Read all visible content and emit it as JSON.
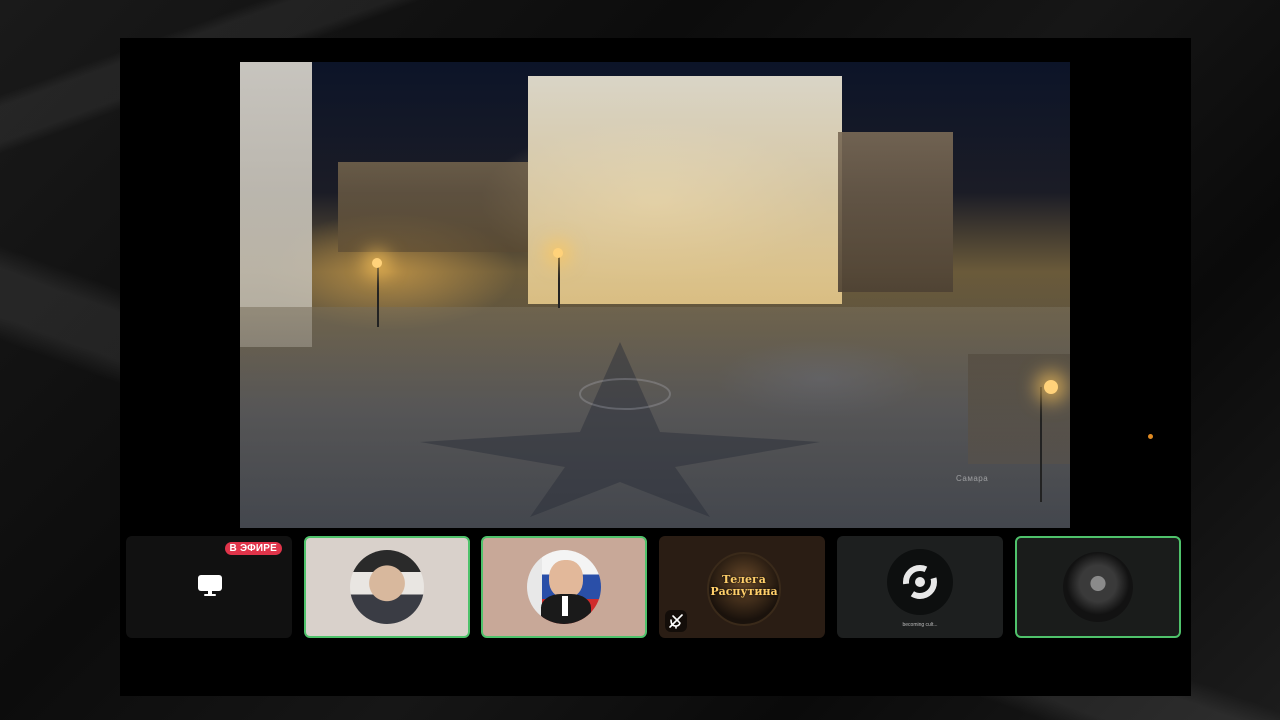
{
  "main_video": {
    "watermark": "Самара"
  },
  "participants": [
    {
      "id": "screen-share",
      "badge": "В ЭФИРЕ",
      "icon": "monitor-icon",
      "active": false,
      "bg": "#111111"
    },
    {
      "id": "participant-2",
      "icon": "avatar",
      "active": true,
      "bg": "#d9d1cb"
    },
    {
      "id": "participant-3",
      "icon": "avatar",
      "active": true,
      "bg": "#c8a898"
    },
    {
      "id": "participant-4",
      "logo_text": "Телега Распутина",
      "icon": "mic-off-icon",
      "active": false,
      "bg": "#2a1d14"
    },
    {
      "id": "participant-5",
      "caption": "becoming cult...",
      "active": false,
      "bg": "#1d1f1f"
    },
    {
      "id": "participant-6",
      "icon": "avatar",
      "active": true,
      "bg": "#1a1c1b"
    }
  ],
  "colors": {
    "active_border": "#4fc26b",
    "live_badge": "#e0344a",
    "accent_dot": "#e08a22"
  }
}
